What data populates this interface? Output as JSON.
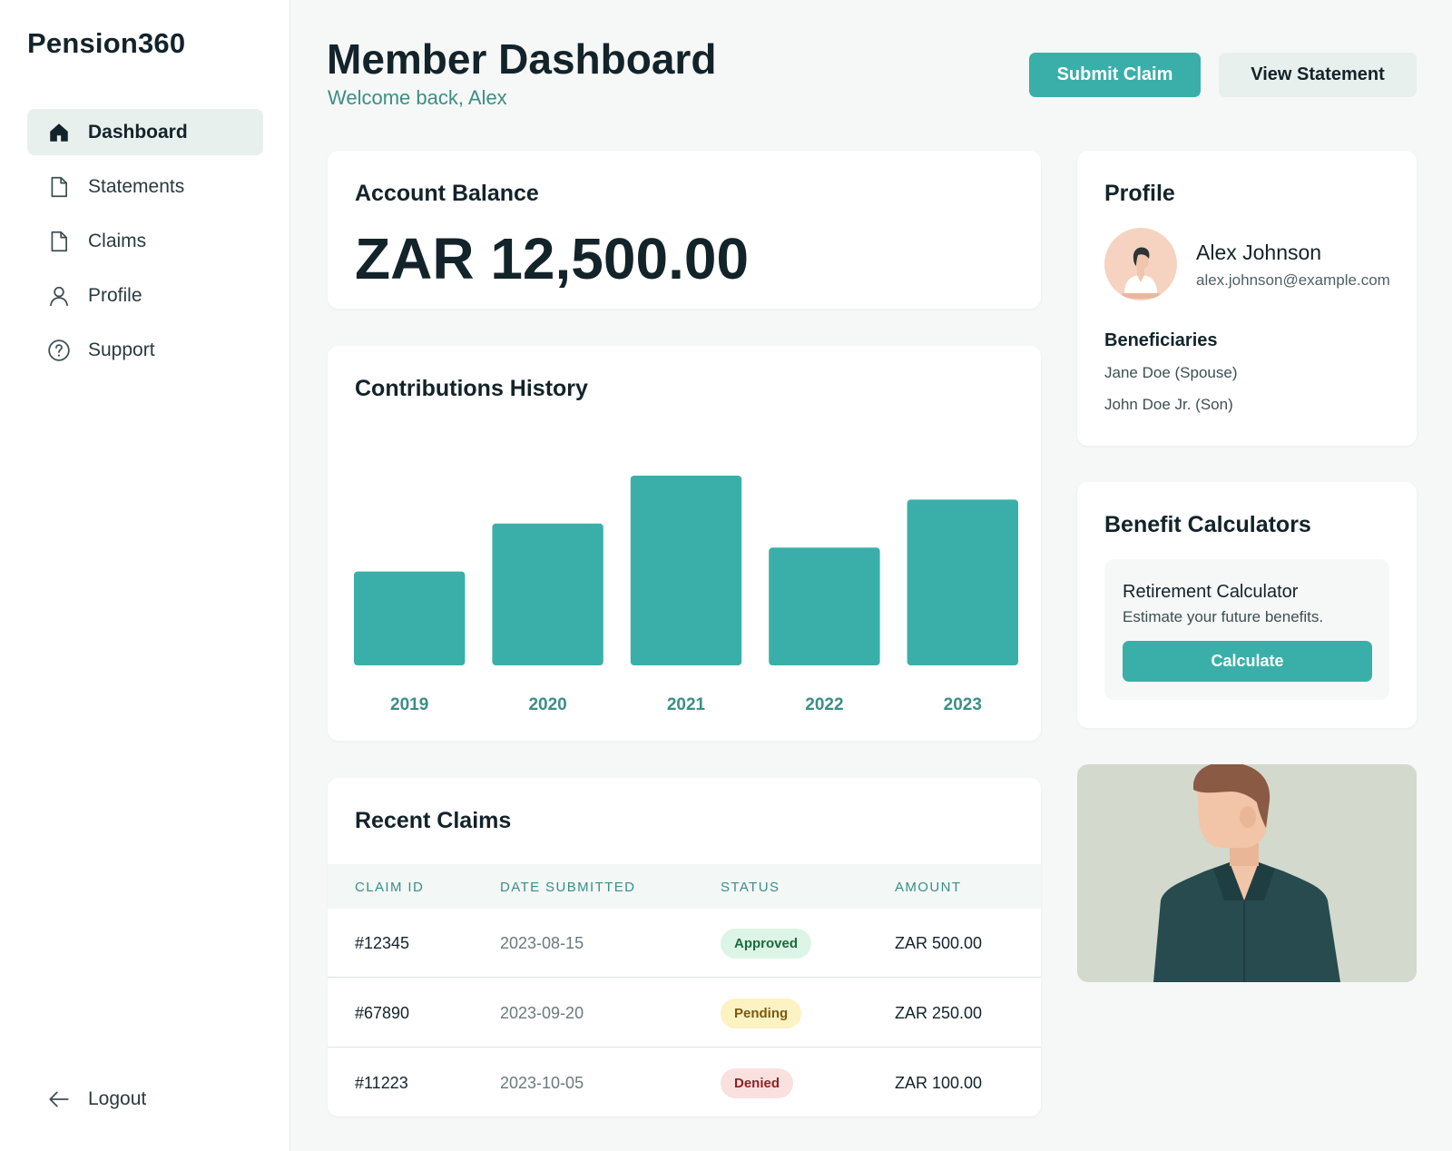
{
  "brand": "Pension360",
  "nav": {
    "items": [
      {
        "label": "Dashboard",
        "icon": "home-icon",
        "active": true
      },
      {
        "label": "Statements",
        "icon": "document-icon"
      },
      {
        "label": "Claims",
        "icon": "document-icon"
      },
      {
        "label": "Profile",
        "icon": "user-icon"
      },
      {
        "label": "Support",
        "icon": "help-circle-icon"
      }
    ],
    "logout": "Logout"
  },
  "header": {
    "title": "Member Dashboard",
    "welcome": "Welcome back, Alex",
    "submit_label": "Submit Claim",
    "statement_label": "View Statement"
  },
  "balance": {
    "title": "Account Balance",
    "value": "ZAR 12,500.00"
  },
  "contributions": {
    "title": "Contributions History"
  },
  "chart_data": {
    "type": "bar",
    "title": "Contributions History",
    "categories": [
      "2019",
      "2020",
      "2021",
      "2022",
      "2023"
    ],
    "values": [
      47,
      71,
      95,
      59,
      83
    ],
    "ylim": [
      0,
      100
    ],
    "grid": false,
    "bar_color": "#3aafa9",
    "label_color": "#3a8f86"
  },
  "claims": {
    "title": "Recent Claims",
    "columns": [
      "CLAIM ID",
      "DATE SUBMITTED",
      "STATUS",
      "AMOUNT"
    ],
    "rows": [
      {
        "id": "#12345",
        "date": "2023-08-15",
        "status": "Approved",
        "amount": "ZAR 500.00"
      },
      {
        "id": "#67890",
        "date": "2023-09-20",
        "status": "Pending",
        "amount": "ZAR 250.00"
      },
      {
        "id": "#11223",
        "date": "2023-10-05",
        "status": "Denied",
        "amount": "ZAR 100.00"
      }
    ],
    "status_colors": {
      "Approved": {
        "bg": "#dcf5e6",
        "fg": "#1c6b3a"
      },
      "Pending": {
        "bg": "#fcf2c2",
        "fg": "#7a5a10"
      },
      "Denied": {
        "bg": "#fbe0e0",
        "fg": "#8a2424"
      }
    }
  },
  "profile": {
    "title": "Profile",
    "name": "Alex Johnson",
    "email": "alex.johnson@example.com",
    "beneficiaries_title": "Beneficiaries",
    "beneficiaries": [
      "Jane Doe (Spouse)",
      "John Doe Jr. (Son)"
    ]
  },
  "calculators": {
    "title": "Benefit Calculators",
    "retirement_title": "Retirement Calculator",
    "retirement_desc": "Estimate your future benefits.",
    "button_label": "Calculate"
  },
  "colors": {
    "accent": "#3aafa9",
    "accent_text": "#3a8f86",
    "dark": "#13232a"
  }
}
